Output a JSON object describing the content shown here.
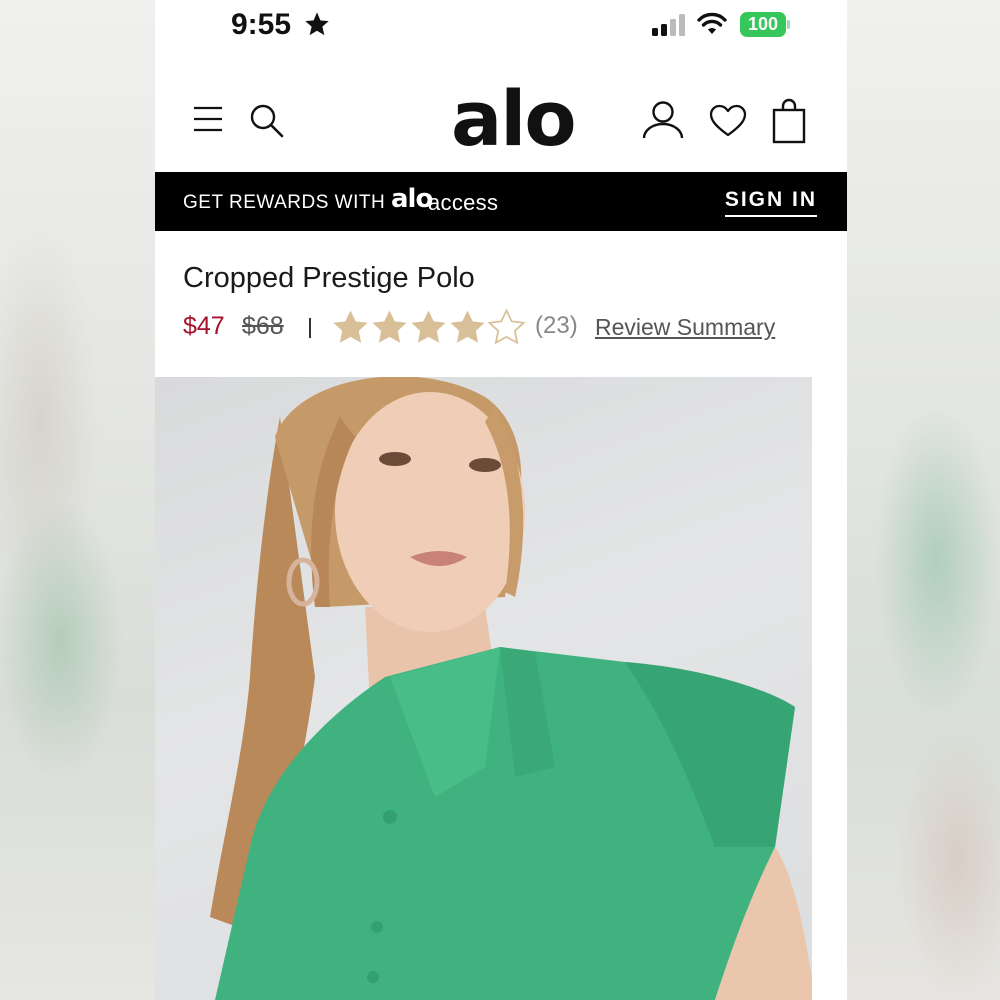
{
  "status_bar": {
    "time": "9:55",
    "battery": "100",
    "battery_color": "#35c759"
  },
  "header": {
    "logo": "alo",
    "icons": [
      "menu-icon",
      "search-icon",
      "account-icon",
      "heart-icon",
      "bag-icon"
    ]
  },
  "banner": {
    "text": "GET REWARDS WITH",
    "logo_word": "alo",
    "logo_suffix": "access",
    "sign_in": "SIGN IN"
  },
  "product": {
    "title": "Cropped Prestige Polo",
    "sale_price": "$47",
    "original_price": "$68",
    "sale_color": "#a4122b",
    "rating": 4,
    "rating_max": 5,
    "review_count": "(23)",
    "review_link": "Review Summary",
    "star_color": "#d8bf98",
    "shirt_color": "#3fb27f"
  }
}
